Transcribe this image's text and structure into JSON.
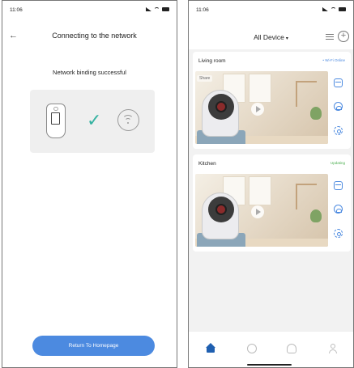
{
  "left_screen": {
    "status_time": "11:06",
    "header_title": "Connecting to the network",
    "back_icon": "arrow-left-icon",
    "success_text": "Network binding successful",
    "return_button_label": "Return To Homepage",
    "accent_color": "#4c8ae0",
    "check_color": "#35b2a1"
  },
  "right_screen": {
    "status_time": "11:06",
    "header_title": "All Device",
    "header_caret": "▾",
    "menu_icon": "menu-lines-icon",
    "add_icon": "add-circle-icon",
    "add_symbol": "+",
    "devices": [
      {
        "name": "Living room",
        "status": "• Wi-Fi Online",
        "status_color": "#4c8ae0",
        "tag": "Share"
      },
      {
        "name": "Kitchen",
        "status": "Updating",
        "status_color": "#4caf50"
      }
    ],
    "side_icons": [
      "calendar-icon",
      "cloud-icon",
      "settings-icon"
    ],
    "tabs": [
      "home-icon",
      "message-icon",
      "cloud-icon",
      "user-icon"
    ],
    "active_tab_color": "#1f5fb0"
  }
}
